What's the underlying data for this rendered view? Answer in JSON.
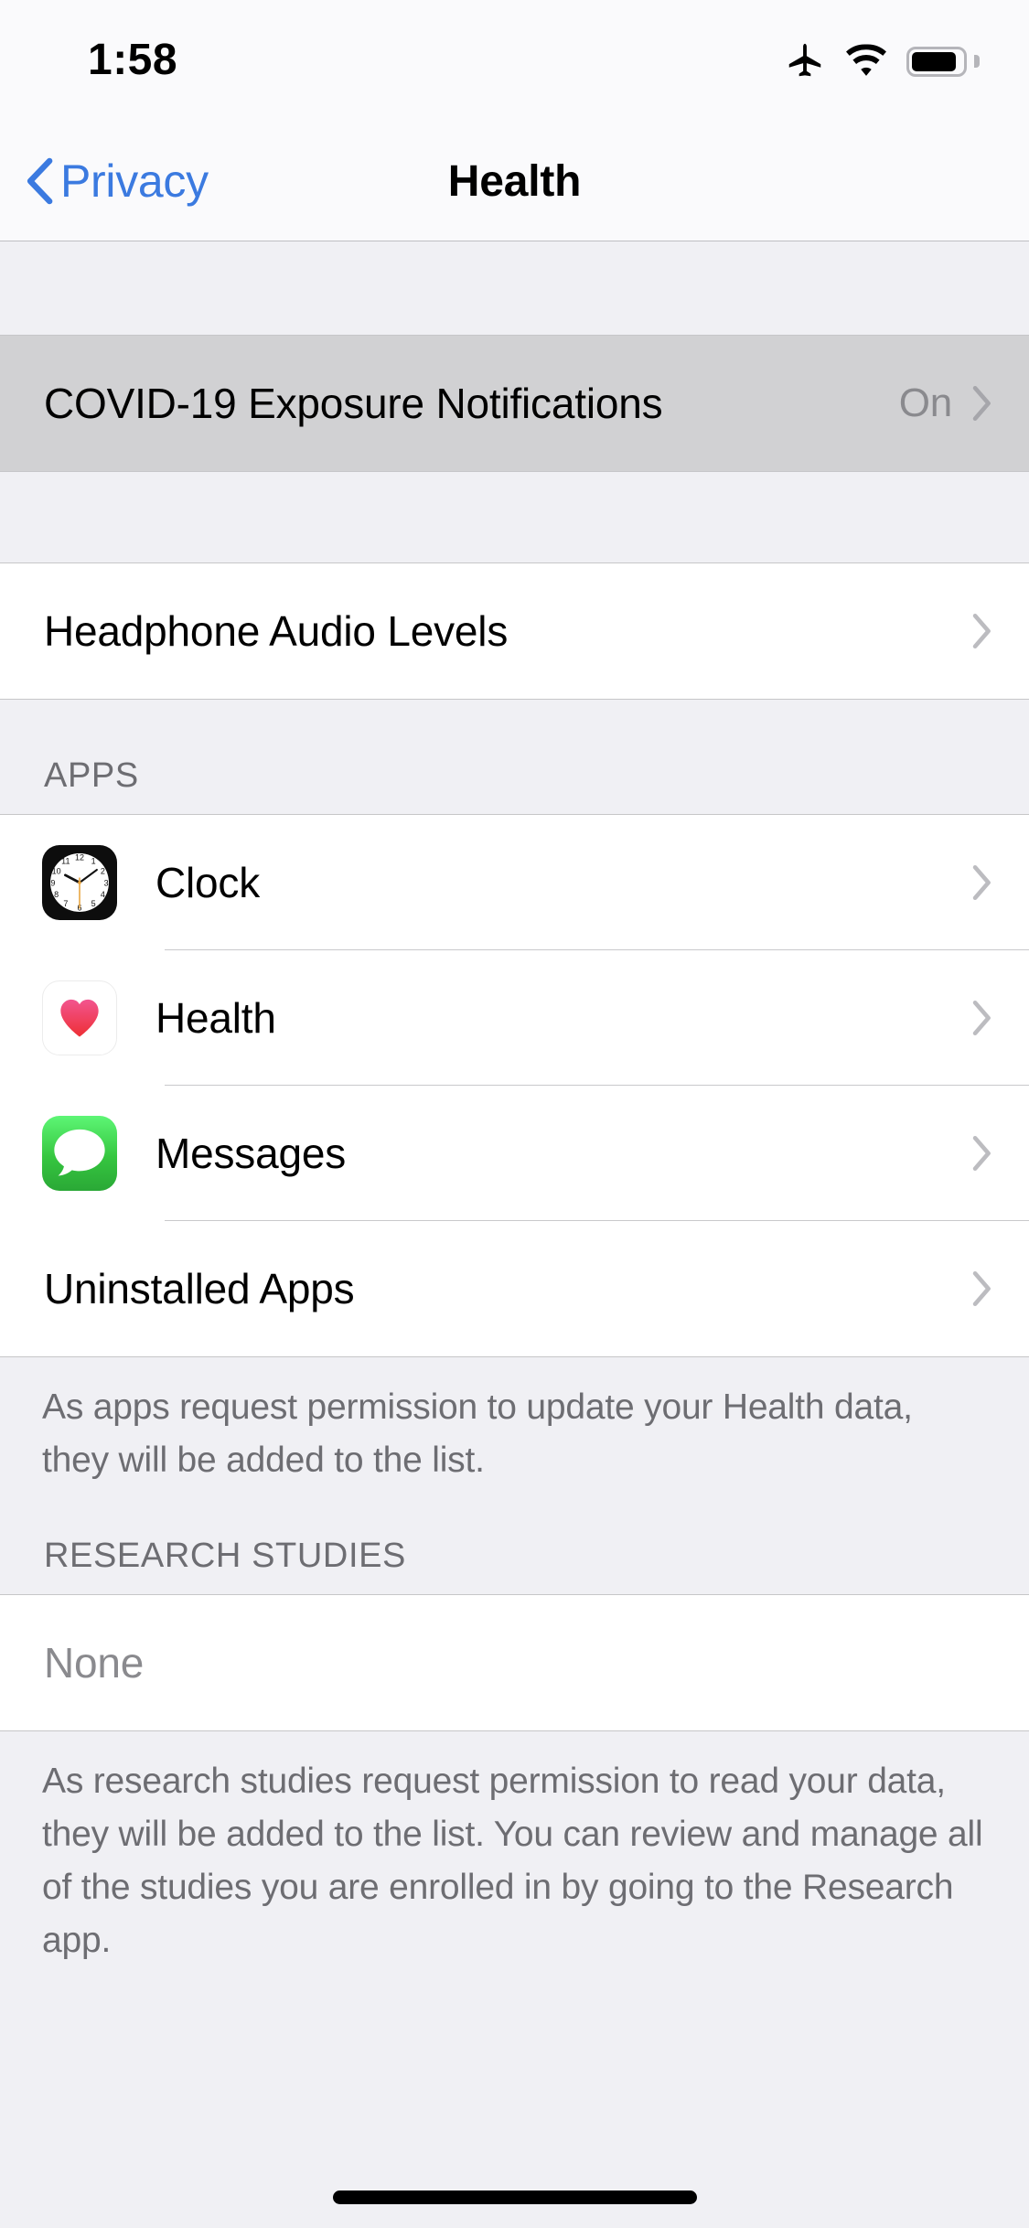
{
  "status_bar": {
    "time": "1:58",
    "icons": [
      "airplane-mode-icon",
      "wifi-icon",
      "battery-icon"
    ],
    "battery_level_percent": 88
  },
  "nav_bar": {
    "back_label": "Privacy",
    "back_icon": "chevron-left-icon",
    "title": "Health"
  },
  "sections": {
    "covid": {
      "row_label": "COVID-19 Exposure Notifications",
      "row_detail": "On",
      "state": "pressed"
    },
    "headphone": {
      "row_label": "Headphone Audio Levels"
    },
    "apps": {
      "header": "APPS",
      "items": [
        {
          "label": "Clock",
          "icon": "clock-app-icon"
        },
        {
          "label": "Health",
          "icon": "health-app-icon"
        },
        {
          "label": "Messages",
          "icon": "messages-app-icon"
        }
      ],
      "uninstalled_label": "Uninstalled Apps",
      "footer": "As apps request permission to update your Health data, they will be added to the list."
    },
    "research_studies": {
      "header": "RESEARCH STUDIES",
      "empty_value": "None",
      "footer": "As research studies request permission to read your data, they will be added to the list. You can review and manage all of the studies you are enrolled in by going to the Research app."
    }
  },
  "colors": {
    "accent_blue": "#3b7ae0",
    "page_background": "#f0f0f4",
    "row_background": "#ffffff",
    "pressed_row_background": "#d1d1d3",
    "secondary_text": "#8a8a8e",
    "footer_text": "#6d6d72",
    "separator": "#c6c6c8",
    "health_heart_red": "#ee4352",
    "messages_green": "#36c640"
  }
}
